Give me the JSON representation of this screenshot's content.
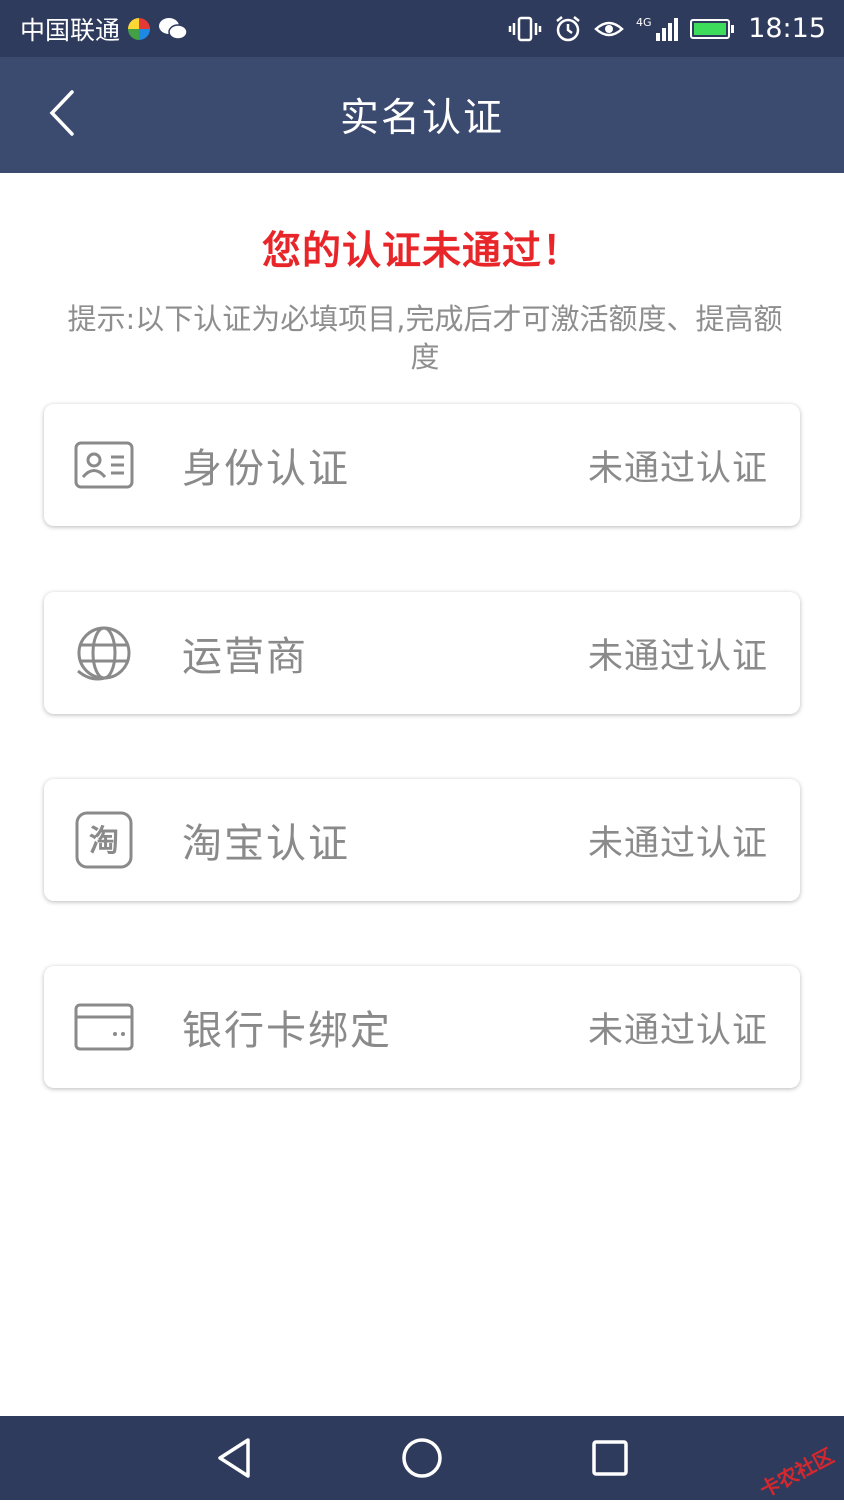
{
  "status_bar": {
    "carrier": "中国联通",
    "time": "18:15",
    "network": "4G",
    "icons": [
      "colorful-app-icon",
      "wechat-icon",
      "vibrate-icon",
      "alarm-icon",
      "eye-icon",
      "signal-icon",
      "battery-icon"
    ]
  },
  "header": {
    "title": "实名认证",
    "back_icon": "chevron-left-icon"
  },
  "main": {
    "headline": "您的认证未通过！",
    "hint": "提示:以下认证为必填项目,完成后才可激活额度、提高额度",
    "items": [
      {
        "label": "身份认证",
        "status": "未通过认证",
        "icon": "id-card-icon"
      },
      {
        "label": "运营商",
        "status": "未通过认证",
        "icon": "carrier-globe-icon"
      },
      {
        "label": "淘宝认证",
        "status": "未通过认证",
        "icon": "taobao-icon",
        "icon_text": "淘"
      },
      {
        "label": "银行卡绑定",
        "status": "未通过认证",
        "icon": "bank-card-icon"
      }
    ]
  },
  "system_nav": {
    "buttons": [
      "back-triangle-icon",
      "home-circle-icon",
      "recents-square-icon"
    ],
    "watermark": "卡农社区"
  },
  "colors": {
    "header_bg": "#3b4a6f",
    "status_bg": "#2f3b5c",
    "headline": "#e8262a",
    "text_gray": "#8a8a8a"
  }
}
